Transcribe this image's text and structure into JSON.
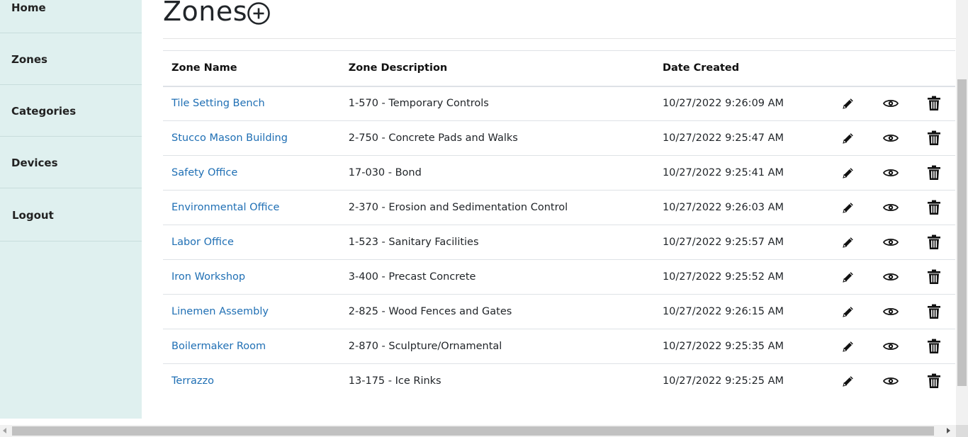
{
  "sidebar": {
    "items": [
      {
        "label": "Home"
      },
      {
        "label": "Zones"
      },
      {
        "label": "Categories"
      },
      {
        "label": "Devices"
      },
      {
        "label": "Logout"
      }
    ]
  },
  "page": {
    "title": "Zones",
    "add_icon": "plus-circle-icon"
  },
  "table": {
    "headers": [
      "Zone Name",
      "Zone Description",
      "Date Created"
    ],
    "rows": [
      {
        "name": "Tile Setting Bench",
        "description": "1-570 - Temporary Controls",
        "date": "10/27/2022 9:26:09 AM"
      },
      {
        "name": "Stucco Mason Building",
        "description": "2-750 - Concrete Pads and Walks",
        "date": "10/27/2022 9:25:47 AM"
      },
      {
        "name": "Safety Office",
        "description": "17-030 - Bond",
        "date": "10/27/2022 9:25:41 AM"
      },
      {
        "name": "Environmental Office",
        "description": "2-370 - Erosion and Sedimentation Control",
        "date": "10/27/2022 9:26:03 AM"
      },
      {
        "name": "Labor Office",
        "description": "1-523 - Sanitary Facilities",
        "date": "10/27/2022 9:25:57 AM"
      },
      {
        "name": "Iron Workshop",
        "description": "3-400 - Precast Concrete",
        "date": "10/27/2022 9:25:52 AM"
      },
      {
        "name": "Linemen Assembly",
        "description": "2-825 - Wood Fences and Gates",
        "date": "10/27/2022 9:26:15 AM"
      },
      {
        "name": "Boilermaker Room",
        "description": "2-870 - Sculpture/Ornamental",
        "date": "10/27/2022 9:25:35 AM"
      },
      {
        "name": "Terrazzo",
        "description": "13-175 - Ice Rinks",
        "date": "10/27/2022 9:25:25 AM"
      }
    ],
    "row_actions": [
      "pencil-icon",
      "eye-icon",
      "trash-icon"
    ]
  },
  "colors": {
    "sidebar_bg": "#dff0ef",
    "link": "#1f6fb4"
  }
}
